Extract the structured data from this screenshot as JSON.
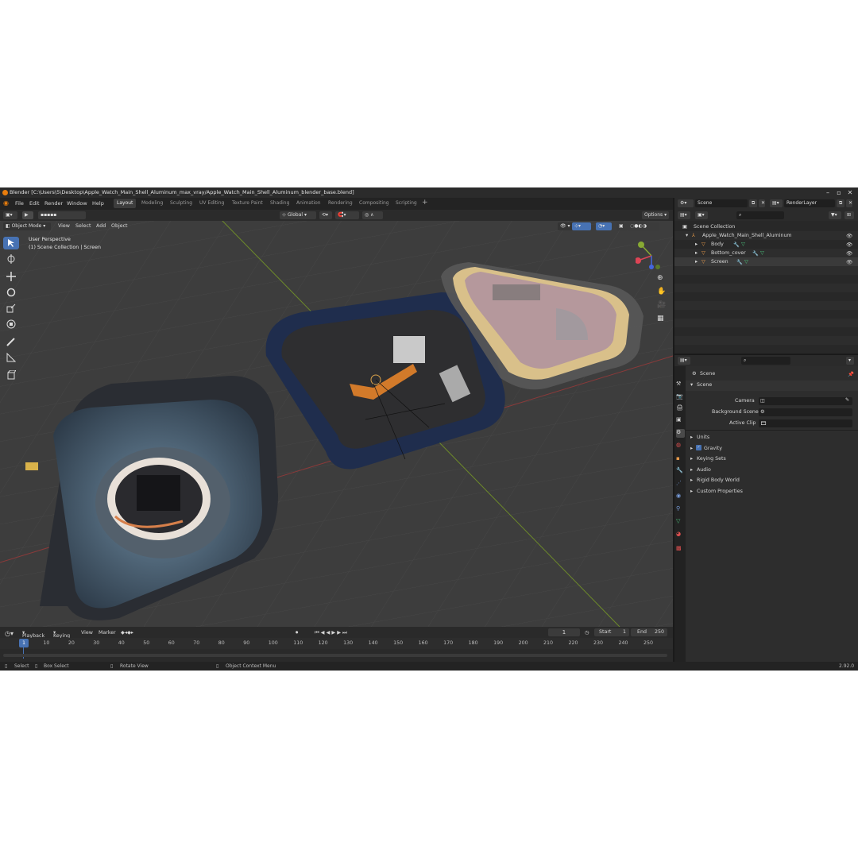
{
  "window": {
    "title": "Blender [C:\\Users\\5\\Desktop\\Apple_Watch_Main_Shell_Aluminum_max_vray/Apple_Watch_Main_Shell_Aluminum_blender_base.blend]"
  },
  "menu": {
    "items": [
      "File",
      "Edit",
      "Render",
      "Window",
      "Help"
    ]
  },
  "workspaces": [
    "Layout",
    "Modeling",
    "Sculpting",
    "UV Editing",
    "Texture Paint",
    "Shading",
    "Animation",
    "Rendering",
    "Compositing",
    "Scripting"
  ],
  "topright": {
    "scene": "Scene",
    "view_layer": "RenderLayer"
  },
  "viewport_header": {
    "transform_orientation": "Global",
    "options": "Options",
    "mode": "Object Mode",
    "view": "View",
    "select": "Select",
    "add": "Add",
    "object": "Object"
  },
  "viewport": {
    "perspective_label": "User Perspective",
    "collection_label": "(1) Scene Collection | Screen"
  },
  "outliner": {
    "root": "Scene Collection",
    "parent": "Apple_Watch_Main_Shell_Aluminum",
    "children": [
      "Body",
      "Bottom_cover",
      "Screen"
    ]
  },
  "properties": {
    "title": "Scene",
    "panel": "Scene",
    "fields": [
      "Camera",
      "Background Scene",
      "Active Clip"
    ],
    "sections": [
      "Units",
      "Gravity",
      "Keying Sets",
      "Audio",
      "Rigid Body World",
      "Custom Properties"
    ]
  },
  "timeline": {
    "playback": "Playback",
    "keying": "Keying",
    "view": "View",
    "marker": "Marker",
    "current_frame": "1",
    "start_label": "Start",
    "start": "1",
    "end_label": "End",
    "end": "250",
    "ticks": [
      "1",
      "10",
      "20",
      "30",
      "40",
      "50",
      "60",
      "70",
      "80",
      "90",
      "100",
      "110",
      "120",
      "130",
      "140",
      "150",
      "160",
      "170",
      "180",
      "190",
      "200",
      "210",
      "220",
      "230",
      "240",
      "250"
    ]
  },
  "statusbar": {
    "select": "Select",
    "box_select": "Box Select",
    "rotate_view": "Rotate View",
    "context_menu": "Object Context Menu",
    "version": "2.92.0"
  }
}
